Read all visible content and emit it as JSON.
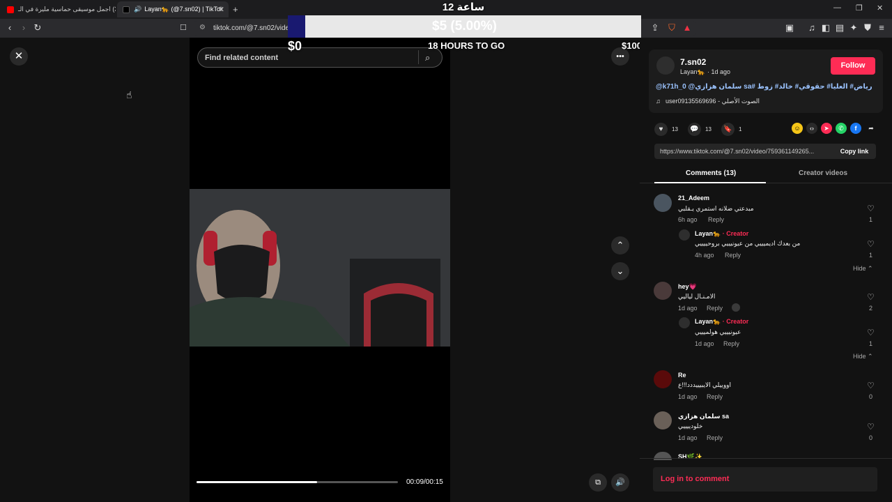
{
  "browser": {
    "tabs": [
      {
        "title": "(3) اجمل موسيقى حماسية مليرة في الـ"
      },
      {
        "title": "Layan🐆 (@7.sn02) | TikTok"
      }
    ],
    "url": "tiktok.com/@7.sn02/video"
  },
  "overlay": {
    "clock": "ساعة 12",
    "percent_label": "$5 (5.00%)",
    "percent_value": 5,
    "min_label": "$0",
    "max_label": "$100",
    "countdown": "18 HOURS TO GO"
  },
  "video": {
    "search_placeholder": "Find related content",
    "time": "00:09/00:15",
    "progress": 0.6
  },
  "author": {
    "username": "7.sn02",
    "display": "Layan🐆",
    "age": "· 1d ago",
    "follow_label": "Follow",
    "caption": "@k71h_0 @سلمان هزازي sa# رياض# العليا# حقوقي# خالد# زوط",
    "sound": "الصوت الأصلي - user09135569696"
  },
  "stats": {
    "likes": "13",
    "comments": "13",
    "saves": "1"
  },
  "link": {
    "url": "https://www.tiktok.com/@7.sn02/video/759361149265...",
    "copy_label": "Copy link"
  },
  "panel_tabs": {
    "comments": "Comments (13)",
    "creator": "Creator videos"
  },
  "comments": [
    {
      "name": "21_Adeem",
      "text": "مبدعتي ضلانه استمري يـقلبي",
      "time": "6h ago",
      "reply": "Reply",
      "likes": "1"
    },
    {
      "name": "Layan🐆",
      "tag": "· Creator",
      "text": "من بعدك اديميييي من عيونيييي بروحييييي",
      "time": "4h ago",
      "reply": "Reply",
      "likes": "1"
    },
    {
      "name": "hey💗",
      "text": "الامـنـال لياليي",
      "time": "1d ago",
      "reply": "Reply",
      "likes": "2"
    },
    {
      "name": "Layan🐆",
      "tag": "· Creator",
      "text": "عيونيييي هولميييي",
      "time": "1d ago",
      "reply": "Reply",
      "likes": "1"
    },
    {
      "name": "Re",
      "text": "اووييلي الايبيييددد!!!ع",
      "time": "1d ago",
      "reply": "Reply",
      "likes": "0"
    },
    {
      "name": "سلمان هزازي sa",
      "text": "خلودييييي",
      "time": "1d ago",
      "reply": "Reply",
      "likes": "0"
    },
    {
      "name": "SH🌿✨"
    }
  ],
  "hide_label": "Hide",
  "login_label": "Log in to comment"
}
